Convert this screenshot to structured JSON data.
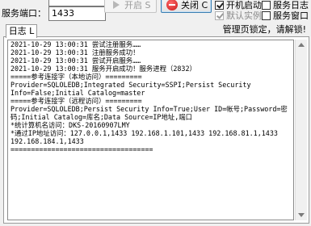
{
  "header": {
    "port_label": "服务端口：",
    "port_value": "1433",
    "top_field_value": ""
  },
  "toolbar": {
    "start_label": "开启 S",
    "close_label": "关闭 C"
  },
  "options": {
    "autostart_label": "开机启动",
    "autostart_checked": true,
    "default_instance_label": "默认实例",
    "default_instance_checked": true,
    "default_instance_disabled": true,
    "service_log_label": "服务日志",
    "service_log_checked": false,
    "service_window_label": "服务窗口",
    "service_window_checked": false
  },
  "lock_notice": "管理页锁定，请解锁!",
  "tabs": [
    {
      "label": "日志 L"
    }
  ],
  "log": {
    "lines": [
      "2021-10-29 13:00:31 尝试注册服务……",
      "2021-10-29 13:00:31 注册服务成功！",
      "2021-10-29 13:00:31 尝试开启服务……",
      "2021-10-29 13:00:31 服务开启成功！服务进程（2832）",
      "=====参考连接字（本地访问）=========",
      "Provider=SQLOLEDB;Integrated Security=SSPI;Persist Security",
      "Info=False;Initial Catalog=master",
      "=====参考连接字（远程访问）=========",
      "Provider=SQLOLEDB;Persist Security Info=True;User ID=帐号;Password=密",
      "码;Initial Catalog=库名;Data Source=IP地址,端口",
      "*统计算机名访问：DKS-20160907LMY",
      "*通过IP地址访问：127.0.0.1,1433 192.168.1.101,1433 192.168.81.1,1433",
      "192.168.184.1,1433",
      "==================================="
    ]
  },
  "colors": {
    "window_bg": "#f0f0f0",
    "close_button_border": "#3c7fb1",
    "stop_icon": "#c81818"
  }
}
